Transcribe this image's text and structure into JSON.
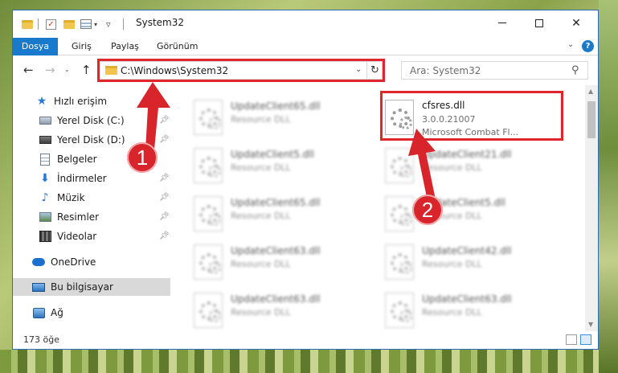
{
  "window": {
    "title": "System32",
    "minimize": "—",
    "maximize": "☐",
    "close": "✕"
  },
  "ribbon": {
    "tabs": [
      {
        "label": "Dosya"
      },
      {
        "label": "Giriş"
      },
      {
        "label": "Paylaş"
      },
      {
        "label": "Görünüm"
      }
    ],
    "help": "?"
  },
  "address": {
    "path": "C:\\Windows\\System32"
  },
  "search": {
    "placeholder": "Ara: System32"
  },
  "sidebar": {
    "items": [
      {
        "label": "Hızlı erişim",
        "icon": "star-icon"
      },
      {
        "label": "Yerel Disk (C:)",
        "icon": "drive-icon"
      },
      {
        "label": "Yerel Disk (D:)",
        "icon": "drive-icon"
      },
      {
        "label": "Belgeler",
        "icon": "documents-icon"
      },
      {
        "label": "İndirmeler",
        "icon": "download-icon"
      },
      {
        "label": "Müzik",
        "icon": "music-icon"
      },
      {
        "label": "Resimler",
        "icon": "pictures-icon"
      },
      {
        "label": "Videolar",
        "icon": "videos-icon"
      },
      {
        "label": "OneDrive",
        "icon": "cloud-icon"
      },
      {
        "label": "Bu bilgisayar",
        "icon": "computer-icon"
      },
      {
        "label": "Ağ",
        "icon": "network-icon"
      }
    ]
  },
  "files": {
    "highlighted": {
      "name": "cfsres.dll",
      "version": "3.0.0.21007",
      "description": "Microsoft Combat Fl..."
    },
    "left": [
      {
        "name": "UpdateClient65.dll",
        "type": "Resource DLL"
      },
      {
        "name": "UpdateClient5.dll",
        "type": "Resource DLL"
      },
      {
        "name": "UpdateClient65.dll",
        "type": "Resource DLL"
      },
      {
        "name": "UpdateClient63.dll",
        "type": "Resource DLL"
      },
      {
        "name": "UpdateClient63.dll",
        "type": "Resource DLL"
      }
    ],
    "right": [
      {
        "name": "UpdateClient21.dll",
        "type": "Resource DLL"
      },
      {
        "name": "UpdateClient5.dll",
        "type": "Resource DLL"
      },
      {
        "name": "UpdateClient42.dll",
        "type": "Resource DLL"
      },
      {
        "name": "UpdateClient63.dll",
        "type": "Resource DLL"
      }
    ]
  },
  "status": {
    "count": "173 öğe"
  },
  "callouts": {
    "one": "1",
    "two": "2",
    "color": "#d8242b"
  },
  "colors": {
    "accent": "#1979ca",
    "highlight": "#e0262c"
  }
}
